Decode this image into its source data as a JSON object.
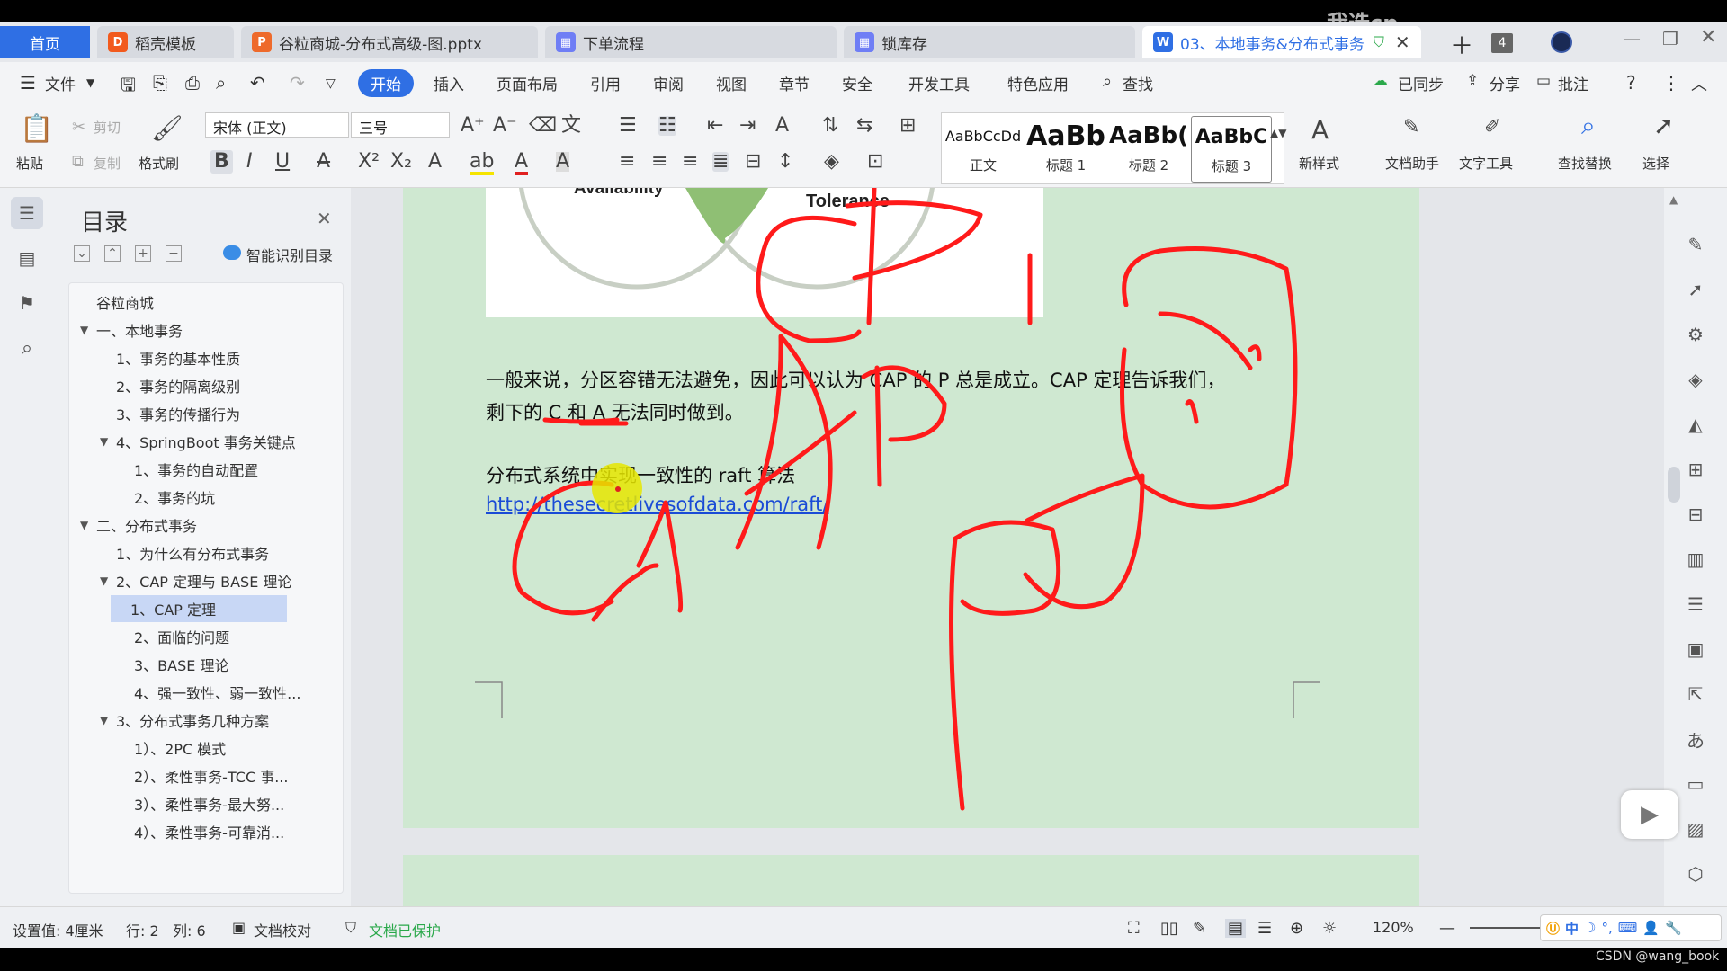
{
  "watermark": "我选cp",
  "csdn_credit": "CSDN @wang_book",
  "tabs": [
    {
      "label": "首页"
    },
    {
      "label": "稻壳模板"
    },
    {
      "label": "谷粒商城-分布式高级-图.pptx"
    },
    {
      "label": "下单流程"
    },
    {
      "label": "锁库存"
    },
    {
      "label": "03、本地事务&分布式事务"
    }
  ],
  "tab_count_badge": "4",
  "menu": {
    "file": "文件",
    "items": [
      "开始",
      "插入",
      "页面布局",
      "引用",
      "审阅",
      "视图",
      "章节",
      "安全",
      "开发工具",
      "特色应用"
    ],
    "search": "查找",
    "sync": "已同步",
    "share": "分享",
    "comment": "批注"
  },
  "ribbon": {
    "paste": "粘贴",
    "cut": "剪切",
    "copy": "复制",
    "format_painter": "格式刷",
    "font_name": "宋体 (正文)",
    "font_size": "三号",
    "styles": [
      {
        "preview": "AaBbCcDd",
        "label": "正文"
      },
      {
        "preview": "AaBb",
        "label": "标题 1"
      },
      {
        "preview": "AaBb(",
        "label": "标题 2"
      },
      {
        "preview": "AaBbC",
        "label": "标题 3"
      }
    ],
    "new_style": "新样式",
    "writing_assistant": "文档助手",
    "text_tools": "文字工具",
    "find_replace": "查找替换",
    "select": "选择"
  },
  "toc": {
    "title": "目录",
    "smart_detect": "智能识别目录",
    "items": [
      {
        "label": "谷粒商城",
        "level": 0,
        "chevron": false,
        "selected": false
      },
      {
        "label": "一、本地事务",
        "level": 0,
        "chevron": true,
        "selected": false
      },
      {
        "label": "1、事务的基本性质",
        "level": 1,
        "chevron": false,
        "selected": false
      },
      {
        "label": "2、事务的隔离级别",
        "level": 1,
        "chevron": false,
        "selected": false
      },
      {
        "label": "3、事务的传播行为",
        "level": 1,
        "chevron": false,
        "selected": false
      },
      {
        "label": "4、SpringBoot 事务关键点",
        "level": 1,
        "chevron": true,
        "selected": false
      },
      {
        "label": "1、事务的自动配置",
        "level": 2,
        "chevron": false,
        "selected": false
      },
      {
        "label": "2、事务的坑",
        "level": 2,
        "chevron": false,
        "selected": false
      },
      {
        "label": "二、分布式事务",
        "level": 0,
        "chevron": true,
        "selected": false
      },
      {
        "label": "1、为什么有分布式事务",
        "level": 1,
        "chevron": false,
        "selected": false
      },
      {
        "label": "2、CAP 定理与 BASE 理论",
        "level": 1,
        "chevron": true,
        "selected": false
      },
      {
        "label": "1、CAP 定理",
        "level": 2,
        "chevron": false,
        "selected": true
      },
      {
        "label": "2、面临的问题",
        "level": 2,
        "chevron": false,
        "selected": false
      },
      {
        "label": "3、BASE 理论",
        "level": 2,
        "chevron": false,
        "selected": false
      },
      {
        "label": "4、强一致性、弱一致性...",
        "level": 2,
        "chevron": false,
        "selected": false
      },
      {
        "label": "3、分布式事务几种方案",
        "level": 1,
        "chevron": true,
        "selected": false
      },
      {
        "label": "1）、2PC 模式",
        "level": 2,
        "chevron": false,
        "selected": false
      },
      {
        "label": "2）、柔性事务-TCC 事...",
        "level": 2,
        "chevron": false,
        "selected": false
      },
      {
        "label": "3）、柔性事务-最大努...",
        "level": 2,
        "chevron": false,
        "selected": false
      },
      {
        "label": "4）、柔性事务-可靠消...",
        "level": 2,
        "chevron": false,
        "selected": false
      }
    ]
  },
  "document": {
    "venn_label_left": "Availability",
    "venn_label_right": "Tolerance",
    "para1_line1": "一般来说，分区容错无法避免，因此可以认为 CAP 的 P 总是成立。CAP 定理告诉我们，",
    "para1_line2": "剩下的 C 和 A 无法同时做到。",
    "para2": "分布式系统中实现一致性的 raft 算法",
    "link": "http://thesecretlivesofdata.com/raft/"
  },
  "status": {
    "setting": "设置值: 4厘米",
    "row": "行: 2",
    "col": "列: 6",
    "proofread": "文档校对",
    "protected": "文档已保护",
    "zoom": "120%"
  },
  "colors": {
    "accent": "#2f6fe4",
    "page_bg": "#cfe8d1",
    "ink": "#ff1a1a",
    "cursor_highlight": "#e6e600"
  }
}
